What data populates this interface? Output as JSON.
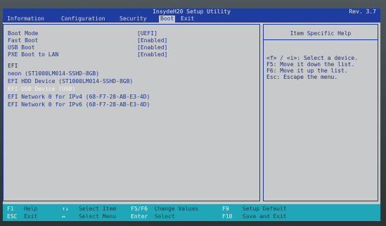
{
  "titlebar": {
    "title": "InsydeH20 Setup Utility",
    "revision": "Rev. 3.7"
  },
  "menu": {
    "information": "Information",
    "configuration": "Configuration",
    "security": "Security",
    "boot": "Boot",
    "exit": "Exit",
    "active": "boot"
  },
  "settings": [
    {
      "label": "Boot Mode",
      "value": "[UEFI]"
    },
    {
      "label": "Fast Boot",
      "value": "[Enabled]"
    },
    {
      "label": "USB Boot",
      "value": "[Enabled]"
    },
    {
      "label": "PXE Boot to LAN",
      "value": "[Enabled]"
    }
  ],
  "boot_priority": {
    "heading": "EFI",
    "devices": [
      {
        "label": "neon (ST1000LM014-SSHD-8GB)",
        "selected": false
      },
      {
        "label": "EFI HDD Device (ST1000LM014-SSHD-8GB)",
        "selected": false
      },
      {
        "label": "EFI USB Device (USB)",
        "selected": true
      },
      {
        "label": "EFI Network 0 for IPv4 (68-F7-28-AB-E3-4D)",
        "selected": false
      },
      {
        "label": "EFI Network 0 for IPv6 (68-F7-28-AB-E3-4D)",
        "selected": false
      }
    ]
  },
  "help_panel": {
    "title": "Item Specific Help",
    "lines": [
      "<f> / <i>: Select a device.",
      "F5: Move it down the list.",
      "F6: Move it up the list.",
      "Esc: Escape the menu."
    ]
  },
  "footer": {
    "f1_key": "F1",
    "f1_desc": "Help",
    "esc_key": "ESC",
    "esc_desc": "Exit",
    "updown_key": "↑↓",
    "updown_desc": "Select Item",
    "leftright_key": "↔",
    "leftright_desc": "Select Menu",
    "f5f6_key": "F5/F6",
    "f5f6_desc": "Change Values",
    "enter_key": "Enter",
    "enter_desc": "Select",
    "f9_key": "F9",
    "f9_desc": "Setup Default",
    "f10_key": "F10",
    "f10_desc": "Save and Exit"
  },
  "colors": {
    "title_bar": "#1f3d9e",
    "panel_background": "#c7c9cb",
    "footer_bar": "#1fa7b8",
    "text_blue": "#1c3393",
    "highlight_text": "#f2f2f2"
  }
}
